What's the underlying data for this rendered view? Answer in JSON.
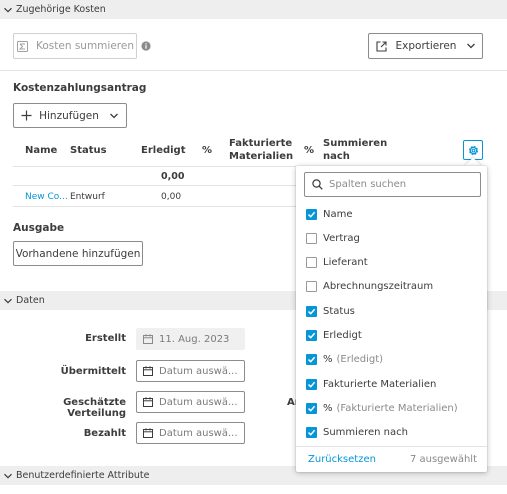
{
  "sections": {
    "related_costs": "Zugehörige Kosten",
    "dates": "Daten",
    "custom_attributes": "Benutzerdefinierte Attribute"
  },
  "toolbar": {
    "sum_costs": "Kosten summieren",
    "export": "Exportieren"
  },
  "payment_request": {
    "title": "Kostenzahlungsantrag",
    "add_label": "Hinzufügen",
    "columns": {
      "name": "Name",
      "status": "Status",
      "done": "Erledigt",
      "pct1": "%",
      "billed_line1": "Fakturierte",
      "billed_line2": "Materialien",
      "pct2": "%",
      "sum_line1": "Summieren",
      "sum_line2": "nach"
    },
    "total_done": "0,00",
    "row": {
      "name": "New Co...",
      "status": "Entwurf",
      "done": "0,00"
    }
  },
  "expense": {
    "title": "Ausgabe",
    "add_existing": "Vorhandene hinzufügen"
  },
  "dates": {
    "created_label": "Erstellt",
    "created_value": "11. Aug. 2023",
    "submitted_label": "Übermittelt",
    "estimated_label": "Geschätzte Verteilung",
    "paid_label": "Bezahlt",
    "placeholder": "Datum auswä...",
    "partial_label": "Ar"
  },
  "column_menu": {
    "search_placeholder": "Spalten suchen",
    "options": [
      {
        "label": "Name",
        "suffix": "",
        "checked": true
      },
      {
        "label": "Vertrag",
        "suffix": "",
        "checked": false
      },
      {
        "label": "Lieferant",
        "suffix": "",
        "checked": false
      },
      {
        "label": "Abrechnungszeitraum",
        "suffix": "",
        "checked": false
      },
      {
        "label": "Status",
        "suffix": "",
        "checked": true
      },
      {
        "label": "Erledigt",
        "suffix": "",
        "checked": true
      },
      {
        "label": "%",
        "suffix": "(Erledigt)",
        "checked": true
      },
      {
        "label": "Fakturierte Materialien",
        "suffix": "",
        "checked": true
      },
      {
        "label": "%",
        "suffix": "(Fakturierte Materialien)",
        "checked": true
      },
      {
        "label": "Summieren nach",
        "suffix": "",
        "checked": true
      }
    ],
    "reset": "Zurücksetzen",
    "selected_count": "7 ausgewählt"
  },
  "colors": {
    "accent": "#0696d7",
    "section_bg": "#eeeeee"
  },
  "icons": {
    "section_toggle": "chevron-down-icon",
    "sum": "sum-icon",
    "info": "info-icon",
    "export": "export-icon",
    "add": "plus-icon",
    "settings": "gear-icon",
    "search": "search-icon",
    "calendar": "calendar-icon"
  }
}
